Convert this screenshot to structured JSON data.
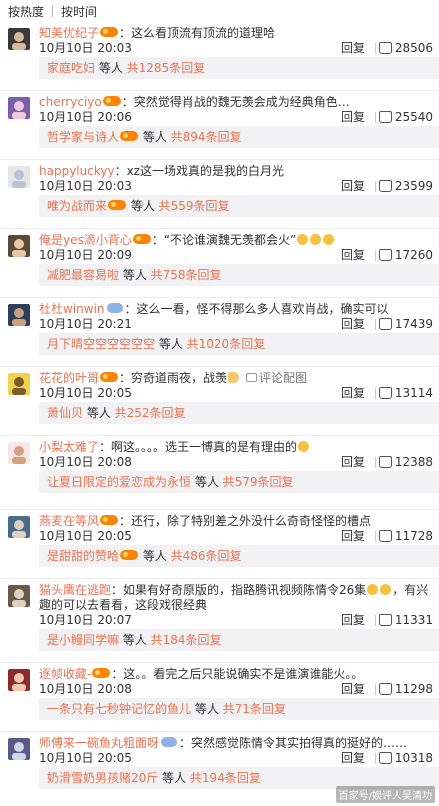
{
  "sort": {
    "hot": "按热度",
    "time": "按时间"
  },
  "reply_label": "回复",
  "comments": [
    {
      "user": "知美优纪子",
      "badge": true,
      "vip": false,
      "text": "：这么看顶流有顶流的道理哈",
      "emojis": [],
      "extra": "",
      "time": "10月10日 20:03",
      "likes": "28506",
      "sub_user": "家庭吃妇",
      "sub_badge": false,
      "sub_extra": " 等人 ",
      "sub_count": "共1285条回复",
      "avatar_colors": [
        "#3a3a3a",
        "#d9b99b"
      ]
    },
    {
      "user": "cherryciyo",
      "badge": true,
      "vip": false,
      "text": "：突然觉得肖战的魏无羡会成为经典角色…",
      "emojis": [],
      "extra": "",
      "time": "10月10日 20:06",
      "likes": "25540",
      "sub_user": "哲学家与诗人",
      "sub_badge": true,
      "sub_extra": " 等人 ",
      "sub_count": "共894条回复",
      "avatar_colors": [
        "#7a5fb0",
        "#f0c9d8"
      ]
    },
    {
      "user": "happyluckyy",
      "badge": false,
      "vip": false,
      "text": "：xz这一场戏真的是我的白月光",
      "emojis": [],
      "extra": "",
      "time": "10月10日 20:03",
      "likes": "23599",
      "sub_user": "唯为战而来",
      "sub_badge": true,
      "sub_extra": " 等人 ",
      "sub_count": "共559条回复",
      "avatar_colors": [
        "#e6e6e6",
        "#b7c4d6"
      ]
    },
    {
      "user": "俺是yes滴小背心",
      "badge": true,
      "vip": false,
      "text": "：“不论谁演魏无羡都会火”",
      "emojis": [
        "face",
        "face",
        "face"
      ],
      "extra": "",
      "time": "10月10日 20:09",
      "likes": "17260",
      "sub_user": "减肥最容易啦",
      "sub_badge": false,
      "sub_extra": " 等人 ",
      "sub_count": "共758条回复",
      "avatar_colors": [
        "#5a4a3a",
        "#e8c8a8"
      ]
    },
    {
      "user": "杜杜winwin",
      "badge": false,
      "vip": true,
      "text": "：这么一看，怪不得那么多人喜欢肖战，确实可以",
      "emojis": [],
      "extra": "",
      "time": "10月10日 20:21",
      "likes": "17439",
      "sub_user": "月下晴空空空空空空",
      "sub_badge": false,
      "sub_extra": " 等人 ",
      "sub_count": "共1020条回复",
      "avatar_colors": [
        "#2d3e5a",
        "#c9a27a"
      ]
    },
    {
      "user": "花花的叶哥",
      "badge": true,
      "vip": false,
      "text": "：穷奇道雨夜，战羡",
      "emojis": [
        "hand"
      ],
      "extra": "评论配图",
      "time": "10月10日 20:05",
      "likes": "13114",
      "sub_user": "萧仙贝",
      "sub_badge": false,
      "sub_extra": " 等人 ",
      "sub_count": "共252条回复",
      "avatar_colors": [
        "#f2d24b",
        "#7c5b2e"
      ]
    },
    {
      "user": "小梨太难了",
      "badge": false,
      "vip": false,
      "text": "：啊这。。。。选王一博真的是有理由的",
      "emojis": [
        "face"
      ],
      "extra": "",
      "time": "10月10日 20:08",
      "likes": "12388",
      "sub_user": "让夏日限定的爱恋成为永恒",
      "sub_badge": false,
      "sub_extra": " 等人 ",
      "sub_count": "共579条回复",
      "avatar_colors": [
        "#f5e6e8",
        "#d7a07c"
      ]
    },
    {
      "user": "燕麦在等风",
      "badge": true,
      "vip": false,
      "text": "：还行，除了特别差之外没什么奇奇怪怪的槽点",
      "emojis": [],
      "extra": "",
      "time": "10月10日 20:05",
      "likes": "11728",
      "sub_user": "是甜甜的赞哈",
      "sub_badge": true,
      "sub_extra": " 等人 ",
      "sub_count": "共486条回复",
      "avatar_colors": [
        "#4a6a8a",
        "#e0d0c0"
      ]
    },
    {
      "user": "猫头鹰在逃跑",
      "badge": false,
      "vip": false,
      "text": "：如果有好奇原版的，指路腾讯视频陈情令26集",
      "emojis": [
        "face",
        "face"
      ],
      "extra": "，有兴",
      "text2": "趣的可以去看看，这段戏很经典",
      "time": "10月10日 20:07",
      "likes": "11331",
      "sub_user": "是小鳗同学嘛",
      "sub_badge": false,
      "sub_extra": " 等人 ",
      "sub_count": "共184条回复",
      "avatar_colors": [
        "#6b5a4a",
        "#ddd2c0"
      ]
    },
    {
      "user": "逐帧收藏-",
      "badge": true,
      "vip": false,
      "text": "：这。。看完之后只能说确实不是谁演谁能火。。",
      "emojis": [],
      "extra": "",
      "time": "10月10日 20:08",
      "likes": "11298",
      "sub_user": "一条只有七秒钟记忆的鱼儿",
      "sub_badge": false,
      "sub_extra": " 等人 ",
      "sub_count": "共71条回复",
      "avatar_colors": [
        "#8a2c2c",
        "#f0c8b0"
      ]
    },
    {
      "user": "师傅来一碗鱼丸粗面呀",
      "badge": false,
      "vip": true,
      "text": "：突然感觉陈情令其实拍得真的挺好的……",
      "emojis": [],
      "extra": "",
      "time": "10月10日 20:05",
      "likes": "10318",
      "sub_user": "奶滑雪奶男孩赌20斤",
      "sub_badge": false,
      "sub_extra": " 等人 ",
      "sub_count": "共194条回复",
      "avatar_colors": [
        "#5a5a8a",
        "#cfd6e6"
      ]
    }
  ],
  "watermark": "百家号/娱评人吴清功"
}
